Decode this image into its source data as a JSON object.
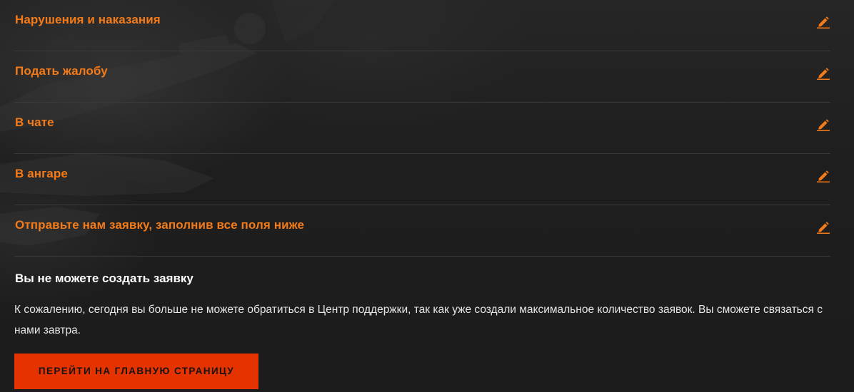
{
  "steps": [
    {
      "title": "Нарушения и наказания"
    },
    {
      "title": "Подать жалобу"
    },
    {
      "title": "В чате"
    },
    {
      "title": "В ангаре"
    },
    {
      "title": "Отправьте нам заявку, заполнив все поля ниже"
    }
  ],
  "notice": {
    "title": "Вы не можете создать заявку",
    "text": "К сожалению, сегодня вы больше не можете обратиться в Центр поддержки, так как уже создали максимальное количество заявок. Вы сможете связаться с нами завтра."
  },
  "home_button": {
    "label": "ПЕРЕЙТИ НА ГЛАВНУЮ СТРАНИЦУ"
  },
  "colors": {
    "accent": "#f57b18",
    "button": "#e53300",
    "background": "#1f1f1f",
    "divider": "#3a3a3a"
  },
  "icons": {
    "edit": "pencil-icon"
  }
}
